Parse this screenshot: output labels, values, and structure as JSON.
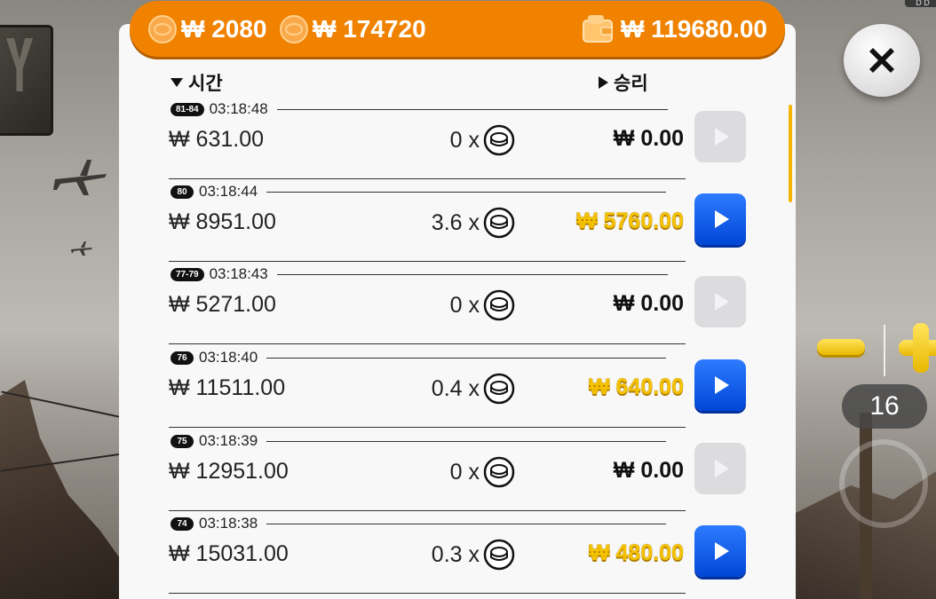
{
  "balances": {
    "coins": "₩ 2080",
    "bet_total": "₩ 174720",
    "wallet": "₩ 119680.00"
  },
  "columns": {
    "time": "시간",
    "win": "승리"
  },
  "rows": [
    {
      "round": "81-84",
      "time": "03:18:48",
      "bet": "₩ 631.00",
      "mult": "0 x",
      "win": "₩ 0.00",
      "won": false
    },
    {
      "round": "80",
      "time": "03:18:44",
      "bet": "₩ 8951.00",
      "mult": "3.6 x",
      "win": "₩ 5760.00",
      "won": true
    },
    {
      "round": "77-79",
      "time": "03:18:43",
      "bet": "₩ 5271.00",
      "mult": "0 x",
      "win": "₩ 0.00",
      "won": false
    },
    {
      "round": "76",
      "time": "03:18:40",
      "bet": "₩ 11511.00",
      "mult": "0.4 x",
      "win": "₩ 640.00",
      "won": true
    },
    {
      "round": "75",
      "time": "03:18:39",
      "bet": "₩ 12951.00",
      "mult": "0 x",
      "win": "₩ 0.00",
      "won": false
    },
    {
      "round": "74",
      "time": "03:18:38",
      "bet": "₩ 15031.00",
      "mult": "0.3 x",
      "win": "₩ 480.00",
      "won": true
    }
  ],
  "controls": {
    "count": "16"
  },
  "colors": {
    "accent": "#f08200",
    "win": "#f5c200",
    "play_active": "#0a5cf0"
  },
  "icons": [
    "coin-icon",
    "wallet-icon",
    "close-icon",
    "play-icon",
    "minus-icon",
    "plus-icon"
  ]
}
